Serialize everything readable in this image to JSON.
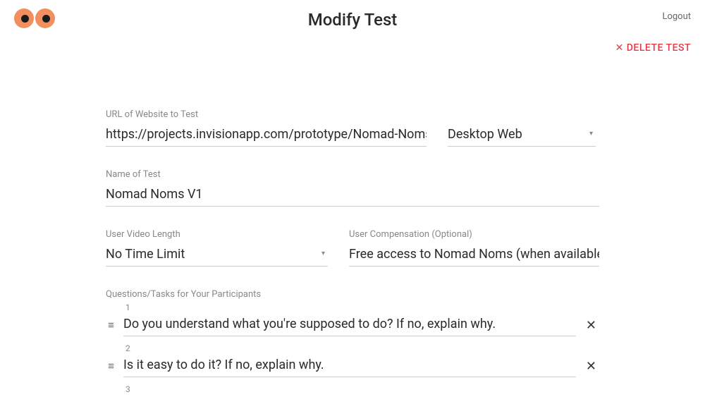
{
  "header": {
    "title": "Modify Test",
    "logout": "Logout"
  },
  "actions": {
    "delete_test": "DELETE TEST"
  },
  "fields": {
    "url": {
      "label": "URL of Website to Test",
      "value": "https://projects.invisionapp.com/prototype/Nomad-Noms-cjqo"
    },
    "device": {
      "label": "",
      "value": "Desktop Web"
    },
    "name": {
      "label": "Name of Test",
      "value": "Nomad Noms V1"
    },
    "video_length": {
      "label": "User Video Length",
      "value": "No Time Limit"
    },
    "compensation": {
      "label": "User Compensation (Optional)",
      "value": "Free access to Nomad Noms (when available)"
    }
  },
  "questions": {
    "label": "Questions/Tasks for Your Participants",
    "items": [
      {
        "num": "1",
        "text": "Do you understand what you're supposed to do? If no, explain why."
      },
      {
        "num": "2",
        "text": "Is it easy to do it? If no, explain why."
      },
      {
        "num": "3",
        "text": ""
      }
    ]
  }
}
